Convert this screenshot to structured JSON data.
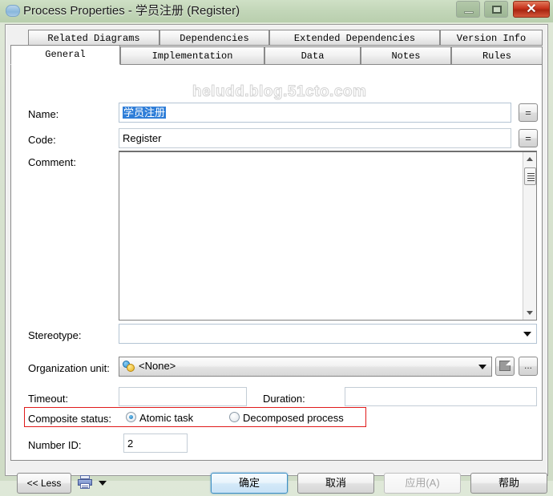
{
  "window": {
    "title": "Process Properties - 学员注册 (Register)",
    "icon": "process-icon",
    "controls": {
      "minimize": "minimize-button",
      "maximize": "maximize-button",
      "close": "✕"
    }
  },
  "tabs": {
    "row1": [
      {
        "label": "Related Diagrams",
        "active": false
      },
      {
        "label": "Dependencies",
        "active": false
      },
      {
        "label": "Extended Dependencies",
        "active": false
      },
      {
        "label": "Version Info",
        "active": false
      }
    ],
    "row2": [
      {
        "label": "General",
        "active": true
      },
      {
        "label": "Implementation",
        "active": false
      },
      {
        "label": "Data",
        "active": false
      },
      {
        "label": "Notes",
        "active": false
      },
      {
        "label": "Rules",
        "active": false
      }
    ]
  },
  "form": {
    "name": {
      "label": "Name:",
      "value": "学员注册",
      "selected": true,
      "equals_button": "="
    },
    "code": {
      "label": "Code:",
      "value": "Register",
      "equals_button": "="
    },
    "comment": {
      "label": "Comment:",
      "value": ""
    },
    "stereotype": {
      "label": "Stereotype:",
      "value": ""
    },
    "organization_unit": {
      "label": "Organization unit:",
      "value": "<None>",
      "icon": "users-icon",
      "properties_button": "properties-icon",
      "browse_button": "..."
    },
    "timeout": {
      "label": "Timeout:",
      "value": ""
    },
    "duration": {
      "label": "Duration:",
      "value": ""
    },
    "composite_status": {
      "label": "Composite status:",
      "options": [
        {
          "label": "Atomic task",
          "selected": true
        },
        {
          "label": "Decomposed process",
          "selected": false
        }
      ],
      "highlight_color": "#e01b1b"
    },
    "number_id": {
      "label": "Number ID:",
      "value": "2"
    }
  },
  "watermark": "heludd.blog.51cto.com",
  "footer": {
    "less_button": "<< Less",
    "print_icon": "printer-icon",
    "print_dropdown": "chevron-down-icon",
    "ok_button": "确定",
    "cancel_button": "取消",
    "apply_button": "应用(A)",
    "help_button": "帮助"
  }
}
